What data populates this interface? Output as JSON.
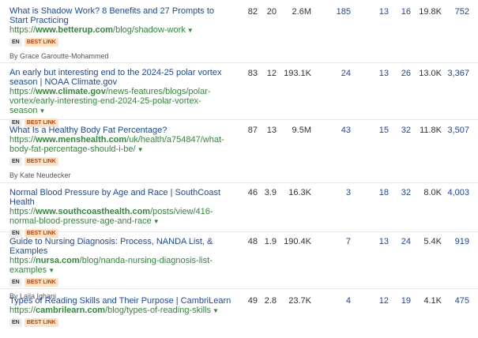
{
  "badges": {
    "lang": "EN",
    "best": "BEST LINK"
  },
  "rows": [
    {
      "title": "What is Shadow Work? 8 Benefits and 27 Prompts to Start Practicing",
      "url_prefix": "https://",
      "url_domain": "www.betterup.com",
      "url_path": "/blog/shadow-work",
      "author": "By Grace Garoutte-Mohammed",
      "c1": "82",
      "c2": "20",
      "c3": "2.6M",
      "c4": "185",
      "c5": "13",
      "c6": "16",
      "c7": "19.8K",
      "c8": "752"
    },
    {
      "title": "An early but interesting end to the 2024-25 polar vortex season | NOAA Climate.gov",
      "url_prefix": "https://",
      "url_domain": "www.climate.gov",
      "url_path": "/news-features/blogs/polar-vortex/early-interesting-end-2024-25-polar-vortex-season",
      "author": "",
      "c1": "83",
      "c2": "12",
      "c3": "193.1K",
      "c4": "24",
      "c5": "13",
      "c6": "26",
      "c7": "13.0K",
      "c8": "3,367"
    },
    {
      "title": "What Is a Healthy Body Fat Percentage?",
      "url_prefix": "https://",
      "url_domain": "www.menshealth.com",
      "url_path": "/uk/health/a754847/what-body-fat-percentage-should-i-be/",
      "author": "By Kate Neudecker",
      "c1": "87",
      "c2": "13",
      "c3": "9.5M",
      "c4": "43",
      "c5": "15",
      "c6": "32",
      "c7": "11.8K",
      "c8": "3,507"
    },
    {
      "title": "Normal Blood Pressure by Age and Race | SouthCoast Health",
      "url_prefix": "https://",
      "url_domain": "www.southcoasthealth.com",
      "url_path": "/posts/view/416-normal-blood-pressure-age-and-race",
      "author": "",
      "c1": "46",
      "c2": "3.9",
      "c3": "16.3K",
      "c4": "3",
      "c5": "18",
      "c6": "32",
      "c7": "8.0K",
      "c8": "4,003"
    },
    {
      "title": "Guide to Nursing Diagnosis: Process, NANDA List, & Examples",
      "url_prefix": "https://",
      "url_domain": "nursa.com",
      "url_path": "/blog/nanda-nursing-diagnosis-list-examples",
      "author": "By Laila Ighani",
      "c1": "48",
      "c2": "1.9",
      "c3": "190.4K",
      "c4": "7",
      "c5": "13",
      "c6": "24",
      "c7": "5.4K",
      "c8": "919"
    },
    {
      "title": "Types of Reading Skills and Their Purpose | CambriLearn",
      "url_prefix": "https://",
      "url_domain": "cambrilearn.com",
      "url_path": "/blog/types-of-reading-skills",
      "author": "",
      "c1": "49",
      "c2": "2.8",
      "c3": "23.7K",
      "c4": "4",
      "c5": "12",
      "c6": "19",
      "c7": "4.1K",
      "c8": "475"
    }
  ]
}
